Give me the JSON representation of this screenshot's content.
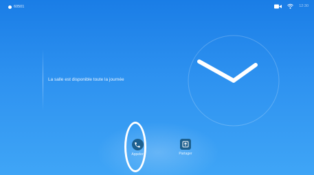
{
  "status": {
    "system_name": "60501",
    "time": "12:30",
    "icons": [
      "camera-icon",
      "wifi-icon"
    ]
  },
  "main": {
    "message": "La salle est disponible toute la journée",
    "clock": {
      "hour": 2,
      "minute": 10
    }
  },
  "actions": [
    {
      "label": "Appeler",
      "icon": "phone-icon"
    },
    {
      "label": "Partager",
      "icon": "share-screen-icon"
    }
  ],
  "colors": {
    "background": "#2e92f0",
    "button": "#1c5f8e",
    "highlight": "#ffffff"
  }
}
